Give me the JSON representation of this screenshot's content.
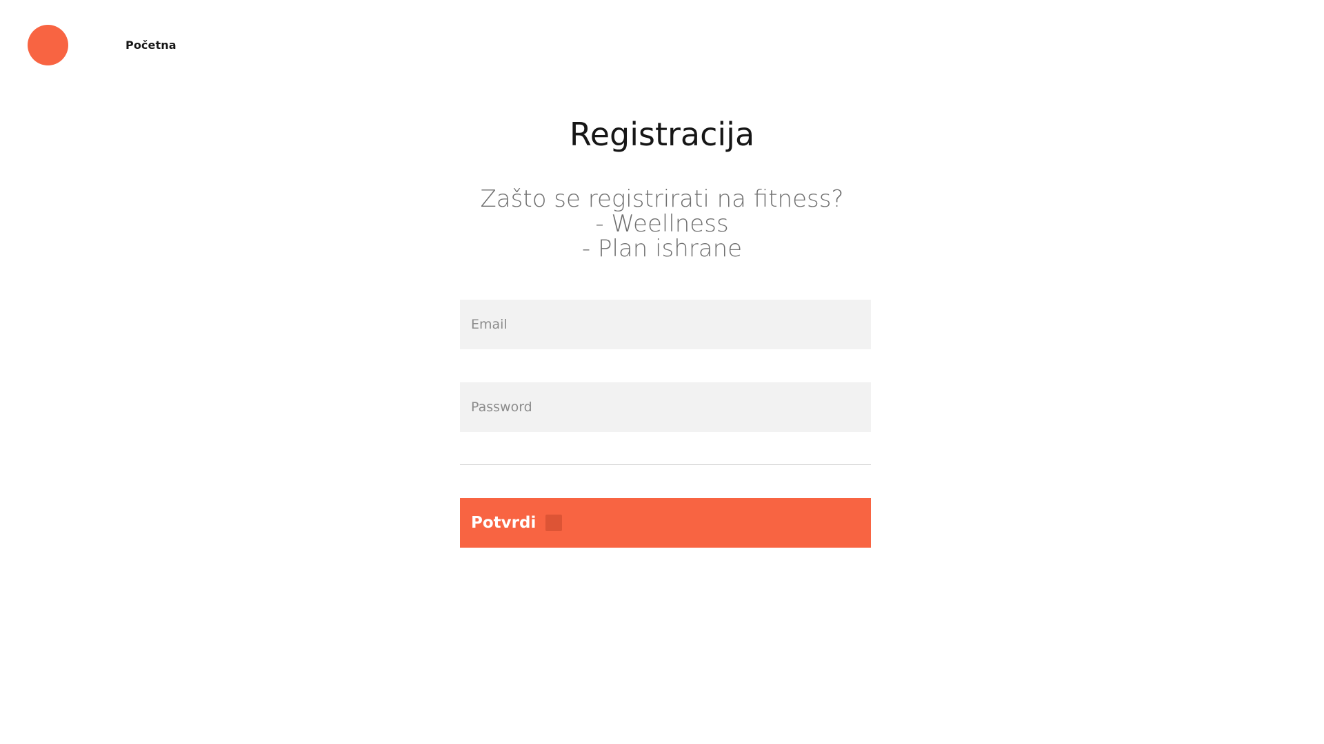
{
  "header": {
    "nav_home_label": "Početna"
  },
  "main": {
    "title": "Registracija",
    "subtitle_lines": [
      "Zašto se registrirati na fitness?",
      "- Weellness",
      "- Plan ishrane"
    ],
    "email_placeholder": "Email",
    "password_placeholder": "Password",
    "submit_label": "Potvrdi"
  },
  "colors": {
    "accent": "#f86442",
    "field_background": "#f2f2f2",
    "title_text": "#161616",
    "subtitle_text": "#6f6f6f"
  }
}
